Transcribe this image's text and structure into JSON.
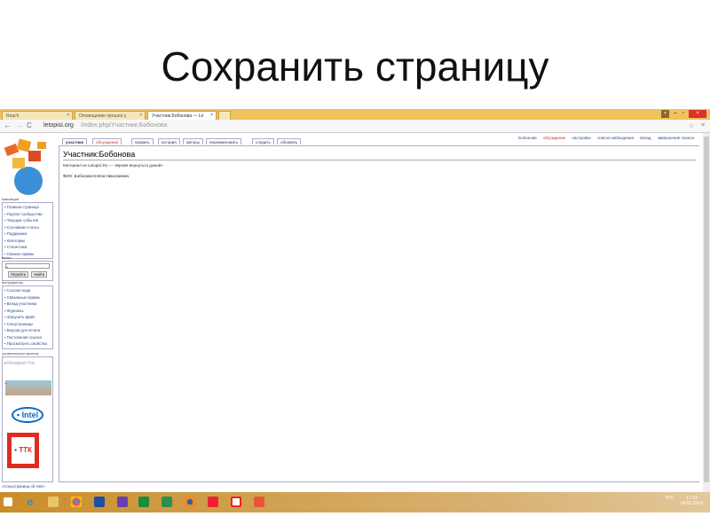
{
  "slide": {
    "title": "Сохранить страницу"
  },
  "browser": {
    "tabs": [
      {
        "label": "Reach"
      },
      {
        "label": "Оповещение прошло у"
      },
      {
        "label": "Участник:Бобонова — Le"
      }
    ],
    "url_domain": "letopisi.org",
    "url_path": "/index.php/Участник:Бобонова"
  },
  "wiki": {
    "page_tabs": [
      "участник",
      "обсуждение",
      "править",
      "история",
      "авторы",
      "переименовать",
      "следить",
      "обновить"
    ],
    "personal": [
      "Бобонова",
      "обсуждение",
      "настройки",
      "список наблюдения",
      "вклад",
      "завершение сеанса"
    ],
    "heading": "Участник:Бобонова",
    "subtitle": "Материал из Letopisi.Ru — «Время вернуться домой»",
    "fio": "ФИО: Бобонова Елена Николаевна",
    "nav_title": "навигация",
    "nav": [
      "Главная страница",
      "Портал сообщества",
      "Текущие события",
      "Случайная статья",
      "Поддержка",
      "Категории",
      "Статистика",
      "Свежие правки"
    ],
    "search_title": "поиск",
    "search_go": "Перейти",
    "search_find": "Найти",
    "tools_title": "инструменты",
    "tools": [
      "Ссылки сюда",
      "Связанные правки",
      "Вклад участника",
      "Журналы",
      "Загрузить файл",
      "Спецстраницы",
      "Версия для печати",
      "Постоянная ссылка",
      "Просмотреть свойства"
    ],
    "org_title": "организаторы проекта",
    "org_logos": [
      "Интернет-Гос",
      "Intel",
      "ТТК"
    ],
    "footer_link": "«Спецстраница об Intel»"
  },
  "taskbar": {
    "time": "17:14",
    "date": "06.02.2016",
    "lang": "РУС"
  }
}
